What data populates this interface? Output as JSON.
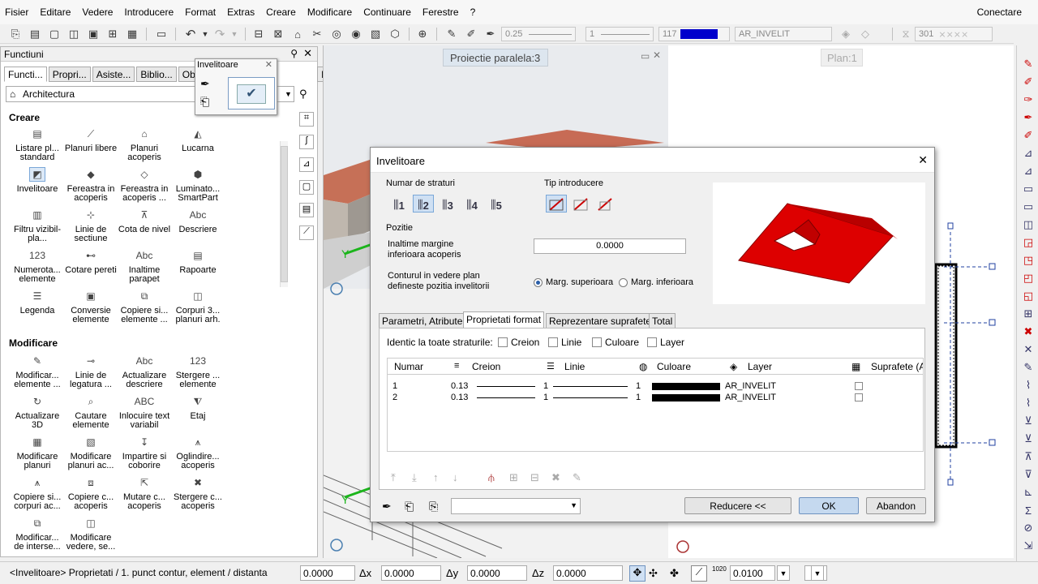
{
  "menu": {
    "items": [
      "Fisier",
      "Editare",
      "Vedere",
      "Introducere",
      "Format",
      "Extras",
      "Creare",
      "Modificare",
      "Continuare",
      "Ferestre",
      "?"
    ],
    "right": "Conectare"
  },
  "toolbar": {
    "pen_thickness": "0.25",
    "line_type": "1",
    "color_index": "117",
    "layer": "AR_INVELIT",
    "hatch_index": "301",
    "accent_color": "#0000cc"
  },
  "left_panel": {
    "title": "Functiuni",
    "tabs": [
      "Functi...",
      "Propri...",
      "Asiste...",
      "Biblio...",
      "Obie",
      "Layer"
    ],
    "combo": "Architectura",
    "creare_title": "Creare",
    "creare_items": [
      {
        "label": "Listare pl... standard",
        "icon": "list-icon"
      },
      {
        "label": "Planuri libere",
        "icon": "free-plane-icon"
      },
      {
        "label": "Planuri acoperis",
        "icon": "roof-plane-icon"
      },
      {
        "label": "Lucarna",
        "icon": "dormer-icon"
      },
      {
        "label": "Invelitoare",
        "icon": "roof-covering-icon"
      },
      {
        "label": "Fereastra in acoperis",
        "icon": "roof-window-icon"
      },
      {
        "label": "Fereastra in acoperis ...",
        "icon": "roof-window-2-icon"
      },
      {
        "label": "Luminato... SmartPart",
        "icon": "skylight-icon"
      },
      {
        "label": "Filtru vizibil-pla...",
        "icon": "filter-icon"
      },
      {
        "label": "Linie de sectiune",
        "icon": "section-line-icon"
      },
      {
        "label": "Cota de nivel",
        "icon": "level-dim-icon"
      },
      {
        "label": "Descriere",
        "icon": "label-icon"
      },
      {
        "label": "Numerota... elemente",
        "icon": "numbering-icon"
      },
      {
        "label": "Cotare pereti",
        "icon": "wall-dim-icon"
      },
      {
        "label": "Inaltime parapet",
        "icon": "parapet-icon"
      },
      {
        "label": "Rapoarte",
        "icon": "report-icon"
      },
      {
        "label": "Legenda",
        "icon": "legend-icon"
      },
      {
        "label": "Conversie elemente",
        "icon": "convert-icon"
      },
      {
        "label": "Copiere si... elemente ...",
        "icon": "copy-icon"
      },
      {
        "label": "Corpuri 3... planuri arh.",
        "icon": "solid-icon"
      }
    ],
    "creare_selected": "Invelitoare",
    "modificare_title": "Modificare",
    "modificare_items": [
      {
        "label": "Modificar... elemente ...",
        "icon": "modify-icon"
      },
      {
        "label": "Linie de legatura ...",
        "icon": "link-line-icon"
      },
      {
        "label": "Actualizare descriere",
        "icon": "update-label-icon"
      },
      {
        "label": "Stergere ... elemente",
        "icon": "delete-icon"
      },
      {
        "label": "Actualizare 3D",
        "icon": "update-3d-icon"
      },
      {
        "label": "Cautare elemente",
        "icon": "search-icon"
      },
      {
        "label": "Inlocuire text variabil",
        "icon": "replace-text-icon"
      },
      {
        "label": "Etaj",
        "icon": "floor-icon"
      },
      {
        "label": "Modificare planuri",
        "icon": "modify-planes-icon"
      },
      {
        "label": "Modificare planuri ac...",
        "icon": "modify-roof-planes-icon"
      },
      {
        "label": "Impartire si coborire",
        "icon": "split-icon"
      },
      {
        "label": "Oglindire... acoperis",
        "icon": "mirror-icon"
      },
      {
        "label": "Copiere si... corpuri ac...",
        "icon": "copy-roof-icon"
      },
      {
        "label": "Copiere c... acoperis",
        "icon": "copy-roof-2-icon"
      },
      {
        "label": "Mutare c... acoperis",
        "icon": "move-roof-icon"
      },
      {
        "label": "Stergere c... acoperis",
        "icon": "delete-roof-icon"
      },
      {
        "label": "Modificar... de interse...",
        "icon": "modify-intersect-icon"
      },
      {
        "label": "Modificare vedere, se...",
        "icon": "modify-view-icon"
      }
    ]
  },
  "small_palette": {
    "title": "Invelitoare"
  },
  "viewport": {
    "title": "Proiectie paralela:3"
  },
  "plan": {
    "title": "Plan:1"
  },
  "dialog": {
    "title": "Invelitoare",
    "strat_label": "Numar de straturi",
    "strat_buttons": [
      "1",
      "2",
      "3",
      "4",
      "5"
    ],
    "tip_label": "Tip introducere",
    "pozitie_label": "Pozitie",
    "inaltime_label": "Inaltime margine inferioara acoperis",
    "inaltime_value": "0.0000",
    "contur_label": "Conturul in vedere plan defineste pozitia invelitorii",
    "radio_sup": "Marg. superioara",
    "radio_inf": "Marg. inferioara",
    "tabs": [
      "Parametri, Atribute",
      "Proprietati format",
      "Reprezentare suprafete",
      "Total"
    ],
    "identic_label": "Identic la toate straturile:",
    "checkboxes": [
      "Creion",
      "Linie",
      "Culoare",
      "Layer"
    ],
    "columns": [
      "Numar",
      "Creion",
      "Linie",
      "Culoare",
      "Layer",
      "Suprafete (Ar"
    ],
    "rows": [
      {
        "numar": "1",
        "creion": "0.13",
        "linie": "1",
        "culoare": "1",
        "layer": "AR_INVELIT"
      },
      {
        "numar": "2",
        "creion": "0.13",
        "linie": "1",
        "culoare": "1",
        "layer": "AR_INVELIT"
      }
    ],
    "btn_reducere": "Reducere <<",
    "btn_ok": "OK",
    "btn_abandon": "Abandon",
    "roof_color": "#dd0000"
  },
  "status": {
    "prompt": "<Invelitoare> Proprietati  /  1. punct contur, element / distanta",
    "field1": "0.0000",
    "dx_label": "Δx",
    "dx": "0.0000",
    "dy_label": "Δy",
    "dy": "0.0000",
    "dz_label": "Δz",
    "dz": "0.0000",
    "snap": "0.0100"
  }
}
